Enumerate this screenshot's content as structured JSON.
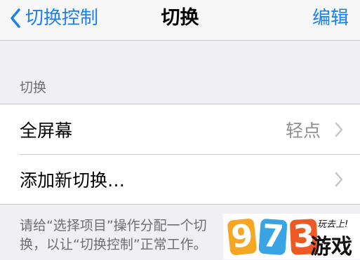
{
  "navbar": {
    "back_label": "切换控制",
    "title": "切换",
    "edit_label": "编辑"
  },
  "section": {
    "header": "切换",
    "rows": [
      {
        "label": "全屏幕",
        "value": "轻点"
      },
      {
        "label": "添加新切换…",
        "value": ""
      }
    ],
    "footer": "请给“选择项目”操作分配一个切换，以让“切换控制”正常工作。"
  },
  "watermark": {
    "digits": [
      "9",
      "7",
      "3"
    ],
    "text": "游戏",
    "small_text": "玩去上!"
  },
  "colors": {
    "accent": "#1a7ff0",
    "background": "#efeff4",
    "secondary_text": "#6d6d72",
    "value_text": "#8e8e93",
    "separator": "#c8c7cc"
  },
  "icons": {
    "back": "chevron-left-icon",
    "disclosure": "chevron-right-icon"
  }
}
